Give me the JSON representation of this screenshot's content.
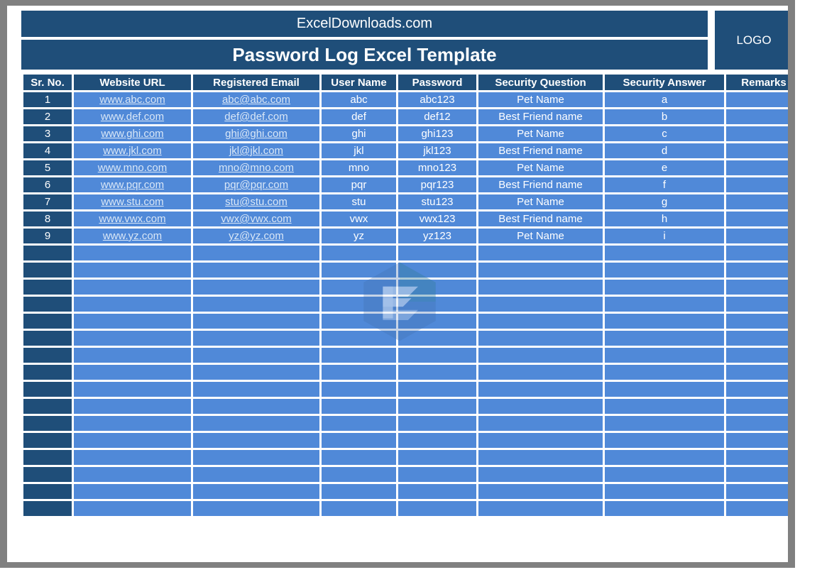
{
  "header": {
    "brand": "ExcelDownloads.com",
    "doc_title": "Password Log Excel Template",
    "logo_label": "LOGO"
  },
  "colors": {
    "header_navy": "#1F4E79",
    "row_blue": "#5089D8",
    "frame_gray": "#808080",
    "text_white": "#FFFFFF",
    "hyperlink": "#D9E7F7"
  },
  "table": {
    "columns": [
      "Sr. No.",
      "Website URL",
      "Registered Email",
      "User Name",
      "Password",
      "Security Question",
      "Security Answer",
      "Remarks"
    ],
    "rows": [
      {
        "sr": "1",
        "url": "www.abc.com",
        "email": "abc@abc.com",
        "user": "abc",
        "password": "abc123",
        "question": "Pet Name",
        "answer": "a",
        "remarks": ""
      },
      {
        "sr": "2",
        "url": "www.def.com",
        "email": "def@def.com",
        "user": "def",
        "password": "def12",
        "question": "Best Friend name",
        "answer": "b",
        "remarks": ""
      },
      {
        "sr": "3",
        "url": "www.ghi.com",
        "email": "ghi@ghi.com",
        "user": "ghi",
        "password": "ghi123",
        "question": "Pet Name",
        "answer": "c",
        "remarks": ""
      },
      {
        "sr": "4",
        "url": "www.jkl.com",
        "email": "jkl@jkl.com",
        "user": "jkl",
        "password": "jkl123",
        "question": "Best Friend name",
        "answer": "d",
        "remarks": ""
      },
      {
        "sr": "5",
        "url": "www.mno.com",
        "email": "mno@mno.com",
        "user": "mno",
        "password": "mno123",
        "question": "Pet Name",
        "answer": "e",
        "remarks": ""
      },
      {
        "sr": "6",
        "url": "www.pqr.com",
        "email": "pqr@pqr.com",
        "user": "pqr",
        "password": "pqr123",
        "question": "Best Friend name",
        "answer": "f",
        "remarks": ""
      },
      {
        "sr": "7",
        "url": "www.stu.com",
        "email": "stu@stu.com",
        "user": "stu",
        "password": "stu123",
        "question": "Pet Name",
        "answer": "g",
        "remarks": ""
      },
      {
        "sr": "8",
        "url": "www.vwx.com",
        "email": "vwx@vwx.com",
        "user": "vwx",
        "password": "vwx123",
        "question": "Best Friend name",
        "answer": "h",
        "remarks": ""
      },
      {
        "sr": "9",
        "url": "www.yz.com",
        "email": "yz@yz.com",
        "user": "yz",
        "password": "yz123",
        "question": "Pet Name",
        "answer": "i",
        "remarks": ""
      },
      {
        "sr": "",
        "url": "",
        "email": "",
        "user": "",
        "password": "",
        "question": "",
        "answer": "",
        "remarks": ""
      },
      {
        "sr": "",
        "url": "",
        "email": "",
        "user": "",
        "password": "",
        "question": "",
        "answer": "",
        "remarks": ""
      },
      {
        "sr": "",
        "url": "",
        "email": "",
        "user": "",
        "password": "",
        "question": "",
        "answer": "",
        "remarks": ""
      },
      {
        "sr": "",
        "url": "",
        "email": "",
        "user": "",
        "password": "",
        "question": "",
        "answer": "",
        "remarks": ""
      },
      {
        "sr": "",
        "url": "",
        "email": "",
        "user": "",
        "password": "",
        "question": "",
        "answer": "",
        "remarks": ""
      },
      {
        "sr": "",
        "url": "",
        "email": "",
        "user": "",
        "password": "",
        "question": "",
        "answer": "",
        "remarks": ""
      },
      {
        "sr": "",
        "url": "",
        "email": "",
        "user": "",
        "password": "",
        "question": "",
        "answer": "",
        "remarks": ""
      },
      {
        "sr": "",
        "url": "",
        "email": "",
        "user": "",
        "password": "",
        "question": "",
        "answer": "",
        "remarks": ""
      },
      {
        "sr": "",
        "url": "",
        "email": "",
        "user": "",
        "password": "",
        "question": "",
        "answer": "",
        "remarks": ""
      },
      {
        "sr": "",
        "url": "",
        "email": "",
        "user": "",
        "password": "",
        "question": "",
        "answer": "",
        "remarks": ""
      },
      {
        "sr": "",
        "url": "",
        "email": "",
        "user": "",
        "password": "",
        "question": "",
        "answer": "",
        "remarks": ""
      },
      {
        "sr": "",
        "url": "",
        "email": "",
        "user": "",
        "password": "",
        "question": "",
        "answer": "",
        "remarks": ""
      },
      {
        "sr": "",
        "url": "",
        "email": "",
        "user": "",
        "password": "",
        "question": "",
        "answer": "",
        "remarks": ""
      },
      {
        "sr": "",
        "url": "",
        "email": "",
        "user": "",
        "password": "",
        "question": "",
        "answer": "",
        "remarks": ""
      },
      {
        "sr": "",
        "url": "",
        "email": "",
        "user": "",
        "password": "",
        "question": "",
        "answer": "",
        "remarks": ""
      },
      {
        "sr": "",
        "url": "",
        "email": "",
        "user": "",
        "password": "",
        "question": "",
        "answer": "",
        "remarks": ""
      }
    ]
  },
  "watermark": {
    "icon": "hexagon-e-logo-watermark"
  }
}
